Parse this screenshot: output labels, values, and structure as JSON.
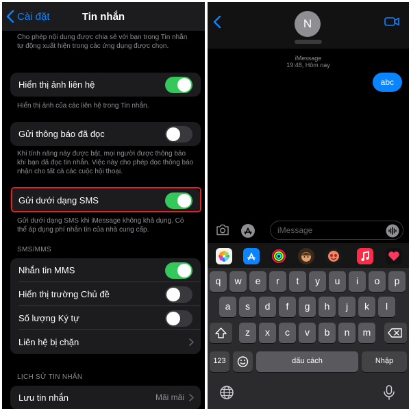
{
  "settings": {
    "back_label": "Cài đặt",
    "title": "Tin nhắn",
    "top_footnote": "Cho phép nội dung được chia sẻ với bạn trong Tin nhắn tự động xuất hiện trong các ứng dụng được chọn.",
    "show_contact_photos": {
      "label": "Hiển thị ảnh liên hệ",
      "on": true,
      "footnote": "Hiển thị ảnh của các liên hệ trong Tin nhắn."
    },
    "read_receipts": {
      "label": "Gửi thông báo đã đọc",
      "on": false,
      "footnote": "Khi tính năng này được bật, mọi người được thông báo khi bạn đã đọc tin nhắn. Việc này cho phép đọc thông báo nhận cho tất cả các cuộc hội thoại."
    },
    "send_as_sms": {
      "label": "Gửi dưới dạng SMS",
      "on": true,
      "footnote": "Gửi dưới dạng SMS khi iMessage không khả dụng. Có thể áp dụng phí nhắn tin của nhà cung cấp."
    },
    "sms_section_header": "SMS/MMS",
    "mms": {
      "label": "Nhắn tin MMS",
      "on": true
    },
    "subject_field": {
      "label": "Hiển thị trường Chủ đề",
      "on": false
    },
    "char_count": {
      "label": "Số lượng Ký tự",
      "on": false
    },
    "blocked": {
      "label": "Liên hệ bị chặn"
    },
    "history_header": "LỊCH SỬ TIN NHẮN",
    "keep_messages": {
      "label": "Lưu tin nhắn",
      "value": "Mãi mãi"
    }
  },
  "messages": {
    "avatar_initial": "N",
    "service_label": "iMessage",
    "timestamp": "19:48, Hôm nay",
    "sent_bubble": "abc",
    "input_placeholder": "iMessage"
  },
  "keyboard": {
    "row1": [
      "q",
      "w",
      "e",
      "r",
      "t",
      "y",
      "u",
      "i",
      "o",
      "p"
    ],
    "row2": [
      "a",
      "s",
      "d",
      "f",
      "g",
      "h",
      "j",
      "k",
      "l"
    ],
    "row3": [
      "z",
      "x",
      "c",
      "v",
      "b",
      "n",
      "m"
    ],
    "numbers_key": "123",
    "space_key": "dấu cách",
    "return_key": "Nhập"
  },
  "colors": {
    "accent": "#0a84ff",
    "toggle_on": "#34c759",
    "highlight_border": "#e02424"
  },
  "icons": {
    "app_strip": [
      "photos-icon",
      "app-store-icon",
      "activity-icon",
      "memoji-icon",
      "memoji-stickers-icon",
      "music-icon",
      "digital-touch-icon"
    ]
  }
}
